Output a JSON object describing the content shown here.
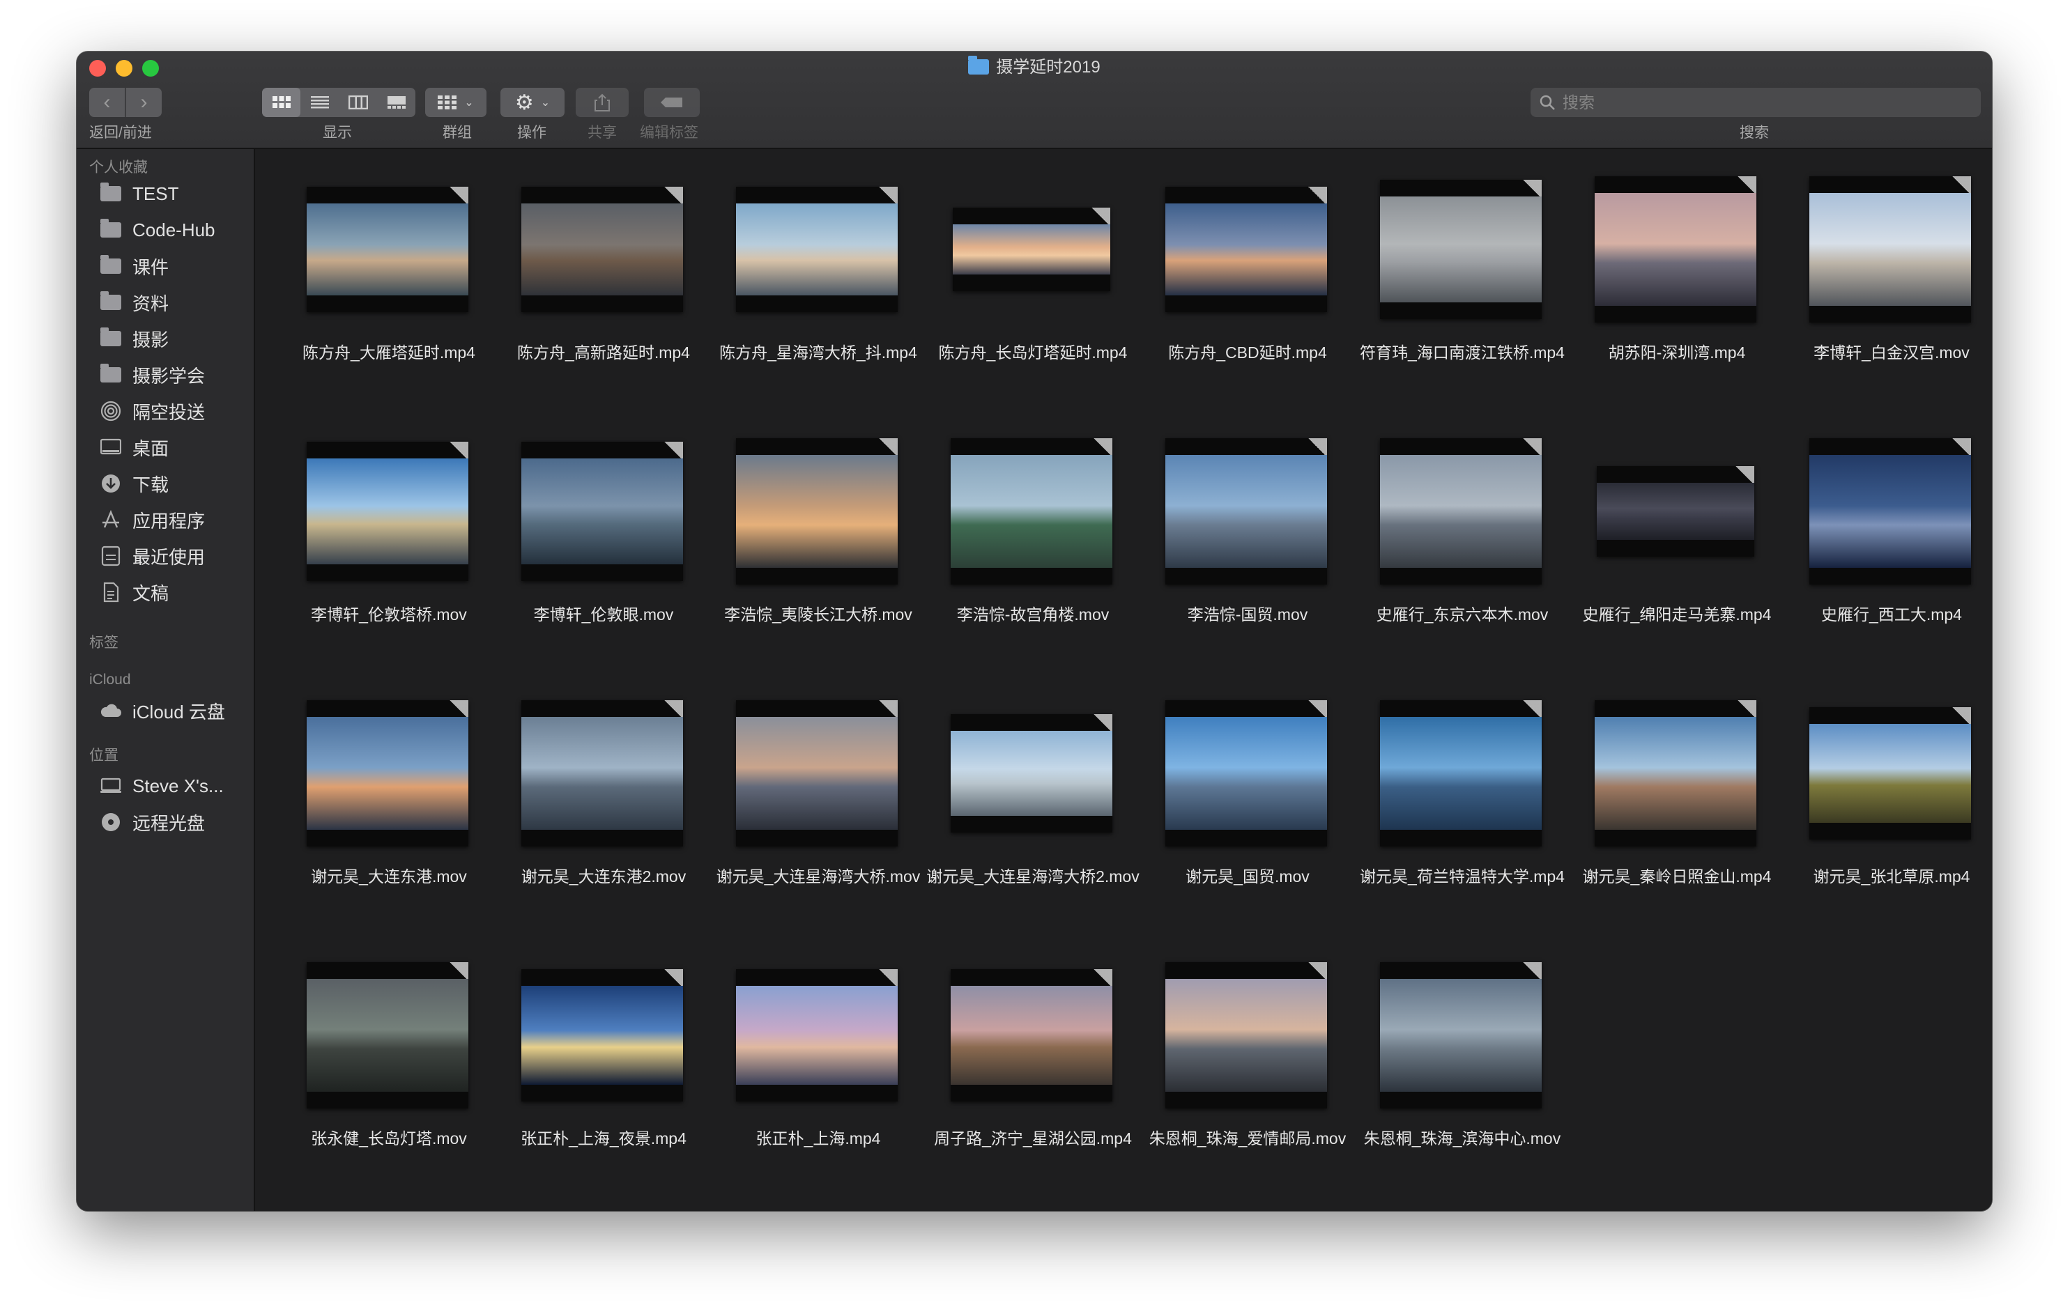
{
  "window": {
    "title": "摄学延时2019"
  },
  "toolbar": {
    "back_forward_label": "返回/前进",
    "view_label": "显示",
    "group_label": "群组",
    "action_label": "操作",
    "share_label": "共享",
    "tags_label": "编辑标签",
    "search_label": "搜索",
    "search_placeholder": "搜索"
  },
  "sidebar": {
    "favorites_header": "个人收藏",
    "favorites": [
      {
        "label": "TEST",
        "icon": "folder-icon"
      },
      {
        "label": "Code-Hub",
        "icon": "folder-icon"
      },
      {
        "label": "课件",
        "icon": "folder-icon"
      },
      {
        "label": "资料",
        "icon": "folder-icon"
      },
      {
        "label": "摄影",
        "icon": "folder-icon"
      },
      {
        "label": "摄影学会",
        "icon": "folder-icon"
      },
      {
        "label": "隔空投送",
        "icon": "airdrop-icon"
      },
      {
        "label": "桌面",
        "icon": "desktop-icon"
      },
      {
        "label": "下载",
        "icon": "download-icon"
      },
      {
        "label": "应用程序",
        "icon": "applications-icon"
      },
      {
        "label": "最近使用",
        "icon": "recents-icon"
      },
      {
        "label": "文稿",
        "icon": "documents-icon"
      }
    ],
    "tags_header": "标签",
    "icloud_header": "iCloud",
    "icloud_items": [
      {
        "label": "iCloud 云盘",
        "icon": "cloud-icon"
      }
    ],
    "locations_header": "位置",
    "locations": [
      {
        "label": "Steve X's...",
        "icon": "computer-icon"
      },
      {
        "label": "远程光盘",
        "icon": "disc-icon"
      }
    ]
  },
  "files": [
    {
      "name": "陈方舟_大雁塔延时.mp4"
    },
    {
      "name": "陈方舟_高新路延时.mp4"
    },
    {
      "name": "陈方舟_星海湾大桥_抖.mp4"
    },
    {
      "name": "陈方舟_长岛灯塔延时.mp4"
    },
    {
      "name": "陈方舟_CBD延时.mp4"
    },
    {
      "name": "符育玮_海口南渡江铁桥.mp4"
    },
    {
      "name": "胡苏阳-深圳湾.mp4"
    },
    {
      "name": "李博轩_白金汉宫.mov"
    },
    {
      "name": "李博轩_伦敦塔桥.mov"
    },
    {
      "name": "李博轩_伦敦眼.mov"
    },
    {
      "name": "李浩悰_夷陵长江大桥.mov"
    },
    {
      "name": "李浩悰-故宫角楼.mov"
    },
    {
      "name": "李浩悰-国贸.mov"
    },
    {
      "name": "史雁行_东京六本木.mov"
    },
    {
      "name": "史雁行_绵阳走马羌寨.mp4"
    },
    {
      "name": "史雁行_西工大.mp4"
    },
    {
      "name": "谢元昊_大连东港.mov"
    },
    {
      "name": "谢元昊_大连东港2.mov"
    },
    {
      "name": "谢元昊_大连星海湾大桥.mov"
    },
    {
      "name": "谢元昊_大连星海湾大桥2.mov"
    },
    {
      "name": "谢元昊_国贸.mov"
    },
    {
      "name": "谢元昊_荷兰特温特大学.mp4"
    },
    {
      "name": "谢元昊_秦岭日照金山.mp4"
    },
    {
      "name": "谢元昊_张北草原.mp4"
    },
    {
      "name": "张永健_长岛灯塔.mov"
    },
    {
      "name": "张正朴_上海_夜景.mp4"
    },
    {
      "name": "张正朴_上海.mp4"
    },
    {
      "name": "周子路_济宁_星湖公园.mp4"
    },
    {
      "name": "朱恩桐_珠海_爱情邮局.mov"
    },
    {
      "name": "朱恩桐_珠海_滨海中心.mov"
    }
  ]
}
